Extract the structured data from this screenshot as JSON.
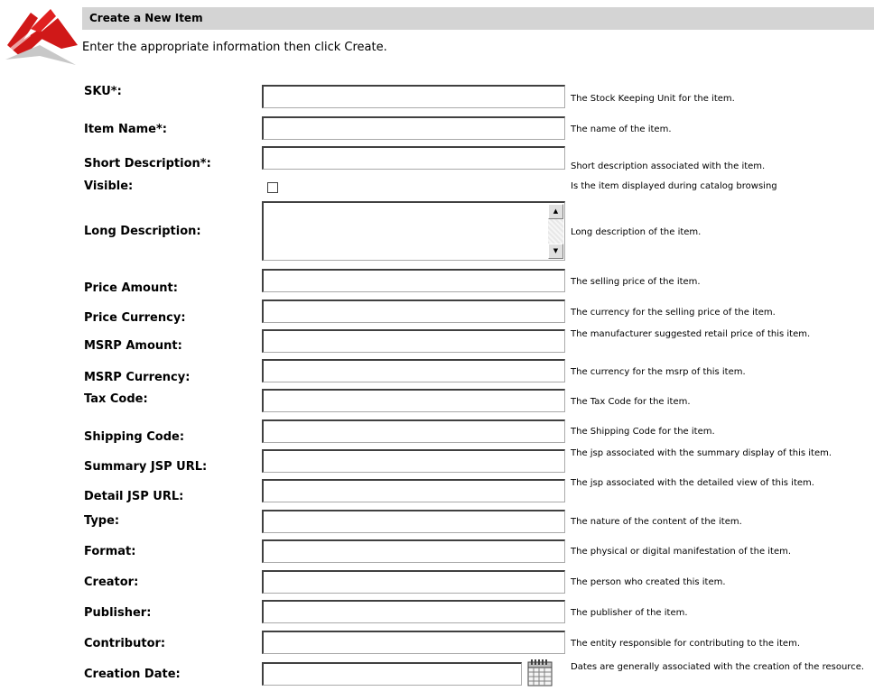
{
  "header": {
    "title": "Create a New Item",
    "instruction": "Enter the appropriate information then click Create."
  },
  "fields": [
    {
      "label": "SKU*:",
      "description": "The Stock Keeping Unit for the item.",
      "value": ""
    },
    {
      "label": "Item Name*:",
      "description": "The name of the item.",
      "value": ""
    },
    {
      "label": "Short Description*:",
      "description": "Short description associated with the item.",
      "value": ""
    },
    {
      "label": "Visible:",
      "description": "Is the item displayed during catalog browsing",
      "checked": false
    },
    {
      "label": "Long Description:",
      "description": "Long description of the item.",
      "value": ""
    },
    {
      "label": "Price Amount:",
      "description": "The selling price of the item.",
      "value": ""
    },
    {
      "label": "Price Currency:",
      "description": "The currency for the selling price of the item.",
      "value": ""
    },
    {
      "label": "MSRP Amount:",
      "description": "The manufacturer suggested retail price of this item.",
      "value": ""
    },
    {
      "label": "MSRP Currency:",
      "description": "The currency for the msrp of this item.",
      "value": ""
    },
    {
      "label": "Tax Code:",
      "description": "The Tax Code for the item.",
      "value": ""
    },
    {
      "label": "Shipping Code:",
      "description": "The Shipping Code for the item.",
      "value": ""
    },
    {
      "label": "Summary JSP URL:",
      "description": "The jsp associated with the summary display of this item.",
      "value": ""
    },
    {
      "label": "Detail JSP URL:",
      "description": "The jsp associated with the detailed view of this item.",
      "value": ""
    },
    {
      "label": "Type:",
      "description": "The nature of the content of the item.",
      "value": ""
    },
    {
      "label": "Format:",
      "description": "The physical or digital manifestation of the item.",
      "value": ""
    },
    {
      "label": "Creator:",
      "description": "The person who created this item.",
      "value": ""
    },
    {
      "label": "Publisher:",
      "description": "The publisher of the item.",
      "value": ""
    },
    {
      "label": "Contributor:",
      "description": "The entity responsible for contributing to the item.",
      "value": ""
    },
    {
      "label": "Creation Date:",
      "description": "Dates are generally associated with the creation of the resource.",
      "value": ""
    }
  ],
  "icons": {
    "logo": "brand-logo",
    "calendar": "calendar-icon",
    "scroll_up": "scroll-up-arrow-icon",
    "scroll_down": "scroll-down-arrow-icon"
  },
  "colors": {
    "header_bar": "#d4d4d4",
    "logo_red": "#d01818"
  }
}
